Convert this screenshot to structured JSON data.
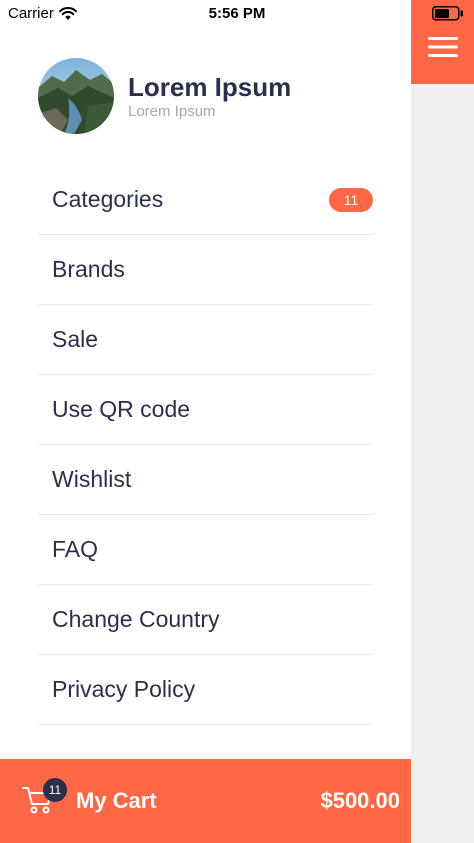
{
  "status_bar": {
    "carrier": "Carrier",
    "time": "5:56 PM"
  },
  "profile": {
    "name": "Lorem Ipsum",
    "subtitle": "Lorem Ipsum"
  },
  "menu": {
    "items": [
      {
        "label": "Categories",
        "badge": "11"
      },
      {
        "label": "Brands"
      },
      {
        "label": "Sale"
      },
      {
        "label": "Use QR code"
      },
      {
        "label": "Wishlist"
      },
      {
        "label": "FAQ"
      },
      {
        "label": "Change Country"
      },
      {
        "label": "Privacy Policy"
      }
    ]
  },
  "cart": {
    "label": "My Cart",
    "count": "11",
    "total": "$500.00"
  },
  "colors": {
    "accent": "#ff6847",
    "text": "#2c2f4a",
    "muted": "#a7a7ad",
    "divider": "#ebebef"
  },
  "icons": {
    "menu": "hamburger-icon",
    "cart": "cart-icon",
    "wifi": "wifi-icon",
    "battery": "battery-icon"
  }
}
